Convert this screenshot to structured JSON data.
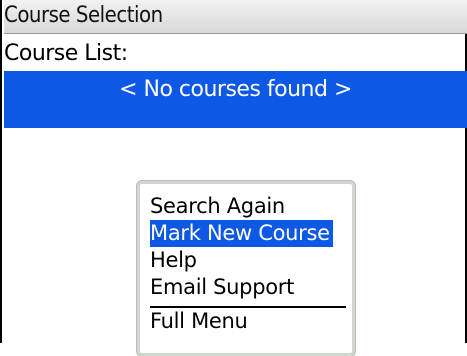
{
  "window": {
    "title": "Course Selection"
  },
  "course_list": {
    "label": "Course List:",
    "empty_message": "< No courses found >"
  },
  "menu": {
    "items": [
      {
        "label": "Search Again",
        "selected": false
      },
      {
        "label": "Mark New Course",
        "selected": true
      },
      {
        "label": "Help",
        "selected": false
      },
      {
        "label": "Email Support",
        "selected": false
      }
    ],
    "full_menu_label": "Full Menu"
  },
  "colors": {
    "highlight": "#0e58e6",
    "title_bar": "#e4e4e4"
  }
}
